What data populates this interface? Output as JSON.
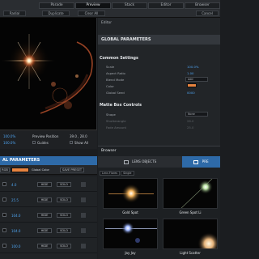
{
  "top_tabs": [
    "Parade",
    "Preview",
    "Stack",
    "Editor",
    "Browser"
  ],
  "top_buttons": {
    "radial": "Radial",
    "duplicate": "Duplicate",
    "clear_all": "Clear All",
    "cancel": "Cancel"
  },
  "preview_status": {
    "row1_left": "100.0%",
    "row1_mid": "Preview Position",
    "row1_right": "39.0 , 28.0",
    "row2_left": "100.0%",
    "row2_mid": "Guides",
    "row2_right": "Show All"
  },
  "left_panel": {
    "title": "AL PARAMETERS",
    "toolbar_left": "RGB",
    "global_color_label": "Global Color",
    "save_preset": "SAVE PRESET",
    "rows": [
      {
        "value": "4.0",
        "hide": "HIDE",
        "solo": "SOLO"
      },
      {
        "value": "25.5",
        "hide": "HIDE",
        "solo": "SOLO"
      },
      {
        "value": "104.0",
        "hide": "HIDE",
        "solo": "SOLO"
      },
      {
        "value": "104.0",
        "hide": "HIDE",
        "solo": "SOLO"
      },
      {
        "value": "100.0",
        "hide": "HIDE",
        "solo": "SOLO"
      }
    ]
  },
  "inspector": {
    "title": "Editor",
    "global_parameters": "GLOBAL PARAMETERS",
    "common_settings": "Common Settings",
    "params": [
      {
        "label": "Scale",
        "value": "100.0%"
      },
      {
        "label": "Aspect Ratio",
        "value": "1.00"
      },
      {
        "label": "Blend Mode",
        "dropdown": "Add"
      },
      {
        "label": "Color",
        "swatch": "#e7833f"
      },
      {
        "label": "Global Seed",
        "value": "0000"
      }
    ],
    "matte_box": "Matte Box Controls",
    "matte_params": [
      {
        "label": "Shape",
        "dropdown": "None"
      },
      {
        "label": "Shutterangle",
        "value": "26.0"
      },
      {
        "label": "Fade Amount",
        "value": "25.0"
      }
    ]
  },
  "browser": {
    "title": "Browser",
    "tab_lens_objects": "LENS OBJECTS",
    "tab_presets": "PRE",
    "crumbs": [
      "Lens Flares",
      "Single"
    ],
    "thumbs": [
      {
        "label": "Gold Spot"
      },
      {
        "label": "Green Spot Li"
      },
      {
        "label": "Jay Jay"
      },
      {
        "label": "Light Scatter"
      }
    ]
  }
}
